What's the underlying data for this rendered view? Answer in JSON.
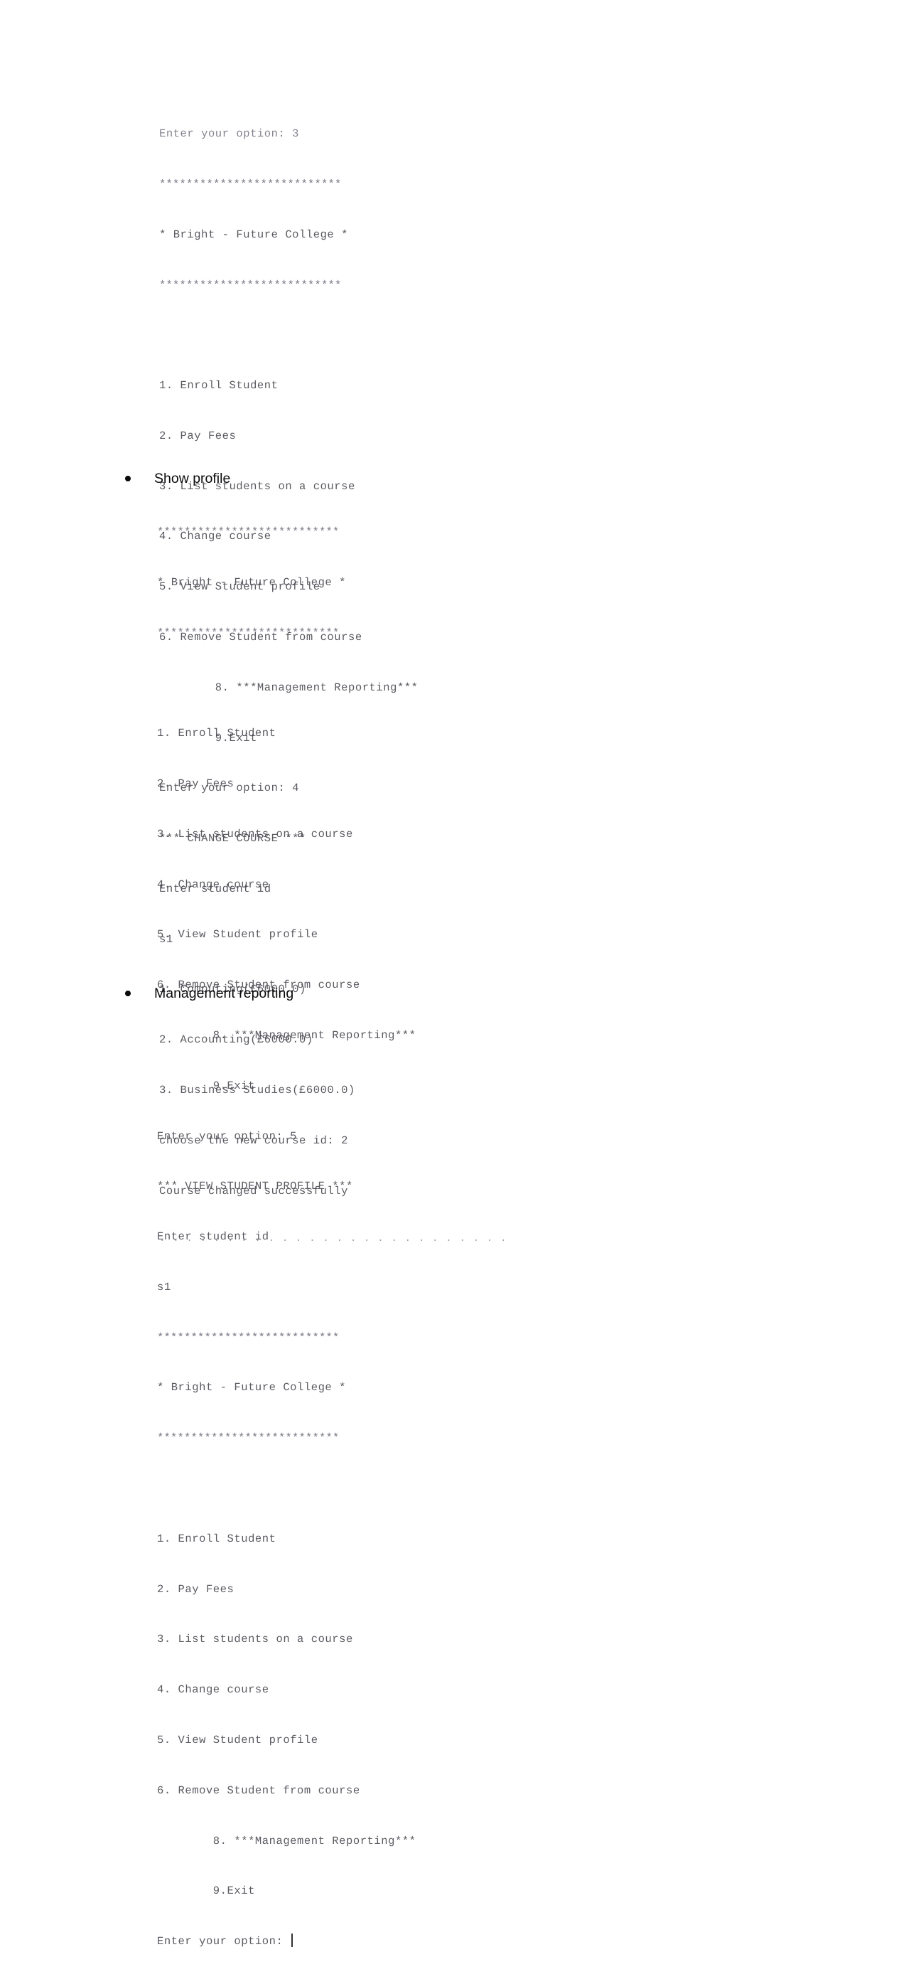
{
  "document": {
    "type": "console-transcript-document",
    "background_color": "#ffffff",
    "console_text_color": "#4a4a52",
    "bullet_text_color": "#0a0a0a"
  },
  "blocks": {
    "block1": {
      "name": "change-course-transcript",
      "truncated_top_line": "Enter your option: 3",
      "lines": [
        "***************************",
        "* Bright - Future College *",
        "***************************",
        "",
        "1. Enroll Student",
        "2. Pay Fees",
        "3. List students on a course",
        "4. Change course",
        "5. View Student profile",
        "6. Remove Student from course",
        "        8. ***Management Reporting***",
        "        9.Exit",
        "Enter your option: 4",
        "*** CHANGE COURSE ***",
        "Enter student id",
        "s1",
        "1. Computing(£6000.0)",
        "2. Accounting(£6000.0)",
        "3. Business Studies(£6000.0)",
        "choose the new course id: 2",
        "Course changed successfully"
      ],
      "separator": ". . . . . . . . . . . . . . . . . . . . . . . . . ."
    },
    "block2": {
      "name": "view-student-profile-transcript",
      "lines": [
        "***************************",
        "* Bright - Future College *",
        "***************************",
        "",
        "1. Enroll Student",
        "2. Pay Fees",
        "3. List students on a course",
        "4. Change course",
        "5. View Student profile",
        "6. Remove Student from course",
        "        8. ***Management Reporting***",
        "        9.Exit",
        "Enter your option: 5",
        "*** VIEW STUDENT PROFILE ***",
        "Enter student id",
        "s1",
        "***************************",
        "* Bright - Future College *",
        "***************************",
        "",
        "1. Enroll Student",
        "2. Pay Fees",
        "3. List students on a course",
        "4. Change course",
        "5. View Student profile",
        "6. Remove Student from course",
        "        8. ***Management Reporting***",
        "        9.Exit"
      ],
      "final_prompt": "Enter your option: "
    }
  },
  "bullets": {
    "show_profile": "Show profile",
    "management_reporting": "Management reporting"
  }
}
